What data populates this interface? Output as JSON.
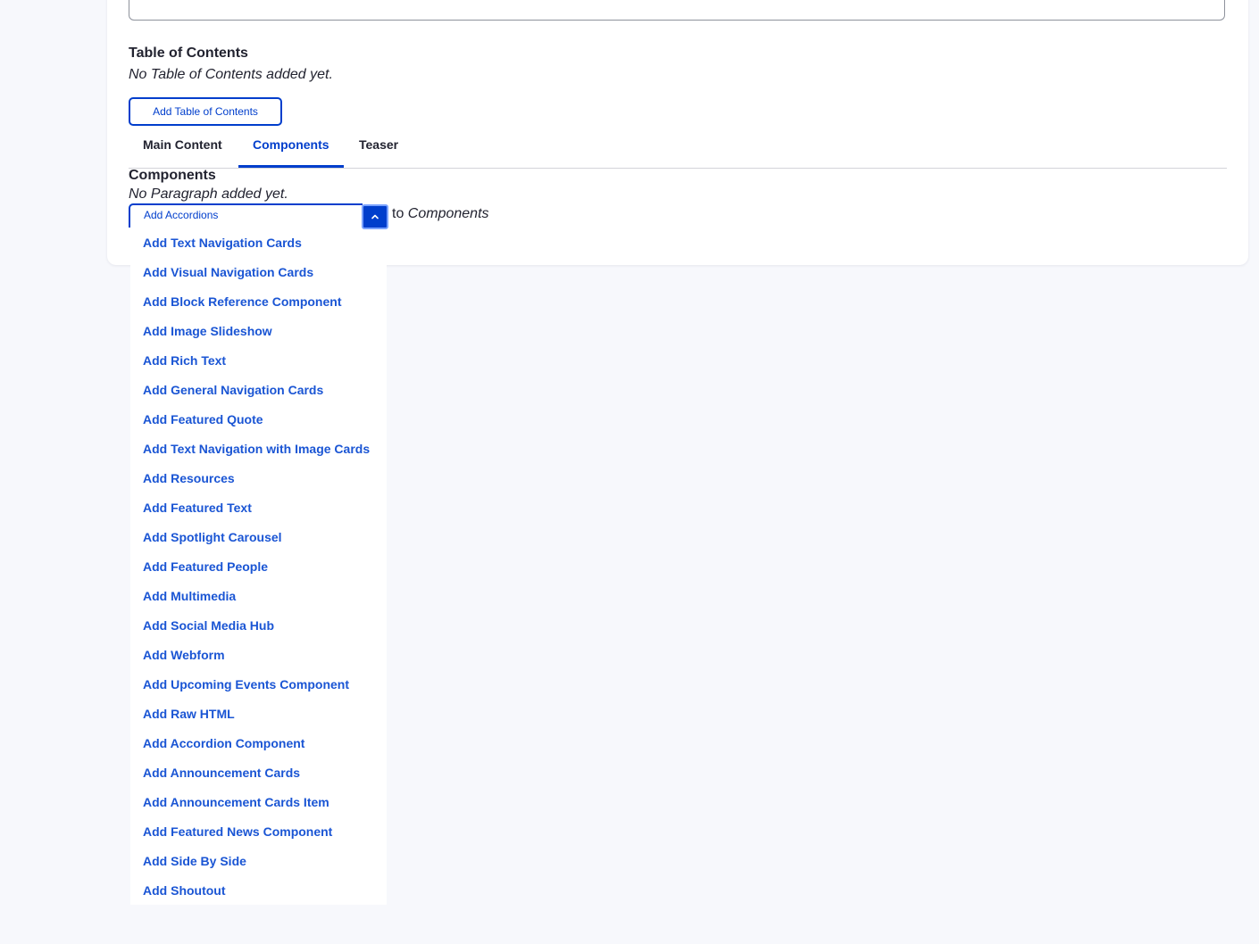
{
  "toc": {
    "heading": "Table of Contents",
    "empty_text": "No Table of Contents added yet.",
    "add_button": "Add Table of Contents"
  },
  "tabs": [
    {
      "label": "Main Content",
      "active": false
    },
    {
      "label": "Components",
      "active": true
    },
    {
      "label": "Teaser",
      "active": false
    }
  ],
  "components": {
    "heading": "Components",
    "empty_text": "No Paragraph added yet.",
    "selected_option": "Add Accordions",
    "to_prefix": "to",
    "to_target": "Components"
  },
  "dropdown": {
    "items": [
      "Add Text Navigation Cards",
      "Add Visual Navigation Cards",
      "Add Block Reference Component",
      "Add Image Slideshow",
      "Add Rich Text",
      "Add General Navigation Cards",
      "Add Featured Quote",
      "Add Text Navigation with Image Cards",
      "Add Resources",
      "Add Featured Text",
      "Add Spotlight Carousel",
      "Add Featured People",
      "Add Multimedia",
      "Add Social Media Hub",
      "Add Webform",
      "Add Upcoming Events Component",
      "Add Raw HTML",
      "Add Accordion Component",
      "Add Announcement Cards",
      "Add Announcement Cards Item",
      "Add Featured News Component",
      "Add Side By Side",
      "Add Shoutout"
    ]
  },
  "colors": {
    "accent": "#003ecc",
    "link": "#1a55d4",
    "background": "#f7f8fc",
    "text": "#222330"
  },
  "icons": {
    "toggle": "chevron-up-icon"
  }
}
